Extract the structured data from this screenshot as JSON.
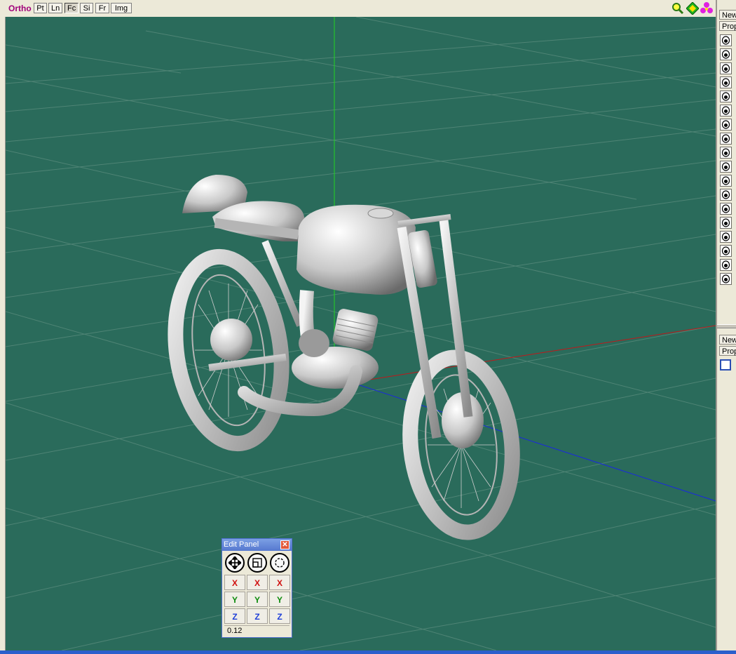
{
  "toolbar": {
    "ortho_label": "Ortho",
    "buttons": [
      "Pt",
      "Ln",
      "Fc",
      "Si",
      "Fr",
      "Img"
    ],
    "active_button": "Fc",
    "icons": [
      "zoom-icon",
      "pan-icon",
      "rotate-icon"
    ]
  },
  "viewport": {
    "background_color": "#2a6b5b",
    "grid_color": "#4f8475",
    "axis_colors": {
      "x": "#c0181a",
      "y": "#22d322",
      "z": "#1a28e0"
    },
    "model": "motorcycle"
  },
  "right_panel": {
    "top_tab": "New",
    "top_subtab": "Prop",
    "visibility_rows": 18,
    "bottom_tab": "New",
    "bottom_subtab": "Prop"
  },
  "edit_panel": {
    "title": "Edit Panel",
    "close_glyph": "✕",
    "tools": [
      "move-icon",
      "scale-icon",
      "rotate-icon"
    ],
    "axes": {
      "x": [
        "X",
        "X",
        "X"
      ],
      "y": [
        "Y",
        "Y",
        "Y"
      ],
      "z": [
        "Z",
        "Z",
        "Z"
      ]
    },
    "value": "0.12"
  }
}
